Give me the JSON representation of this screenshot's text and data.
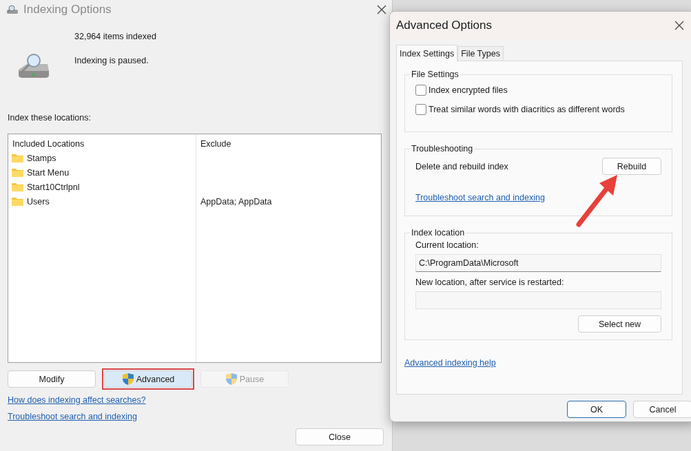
{
  "indexing_window": {
    "title": "Indexing Options",
    "status": [
      "32,964 items indexed",
      "Indexing is paused."
    ],
    "locations_label": "Index these locations:",
    "table": {
      "columns": [
        "Included Locations",
        "Exclude"
      ],
      "rows": [
        {
          "location": "Stamps"
        },
        {
          "location": "Start Menu"
        },
        {
          "location": "Start10Ctrlpnl"
        },
        {
          "location": "Users",
          "exclude": "AppData; AppData"
        }
      ]
    },
    "buttons": [
      {
        "label": "Modify",
        "kind": "plain",
        "highlighted": false,
        "disabled": false
      },
      {
        "label": "Advanced",
        "kind": "shield",
        "highlighted": true,
        "disabled": false
      },
      {
        "label": "Pause",
        "kind": "shield",
        "highlighted": false,
        "disabled": true
      }
    ],
    "links": [
      "How does indexing affect searches?",
      "Troubleshoot search and indexing"
    ],
    "close_button": "Close"
  },
  "advanced_window": {
    "title": "Advanced Options",
    "tabs": [
      {
        "label": "Index Settings",
        "selected": true
      },
      {
        "label": "File Types",
        "selected": false
      }
    ],
    "file_settings": {
      "title": "File Settings",
      "options": [
        {
          "label": "Index encrypted files",
          "checked": false
        },
        {
          "label": "Treat similar words with diacritics as different words",
          "checked": false
        }
      ]
    },
    "troubleshooting": {
      "title": "Troubleshooting",
      "action_label": "Delete and rebuild index",
      "button": "Rebuild",
      "link": "Troubleshoot search and indexing"
    },
    "index_location": {
      "title": "Index location",
      "current_label": "Current location:",
      "current_value": "C:\\ProgramData\\Microsoft",
      "new_label": "New location, after service is restarted:",
      "button": "Select new"
    },
    "help_link": "Advanced indexing help",
    "buttons": [
      {
        "label": "OK",
        "default": true
      },
      {
        "label": "Cancel",
        "default": false
      }
    ]
  }
}
